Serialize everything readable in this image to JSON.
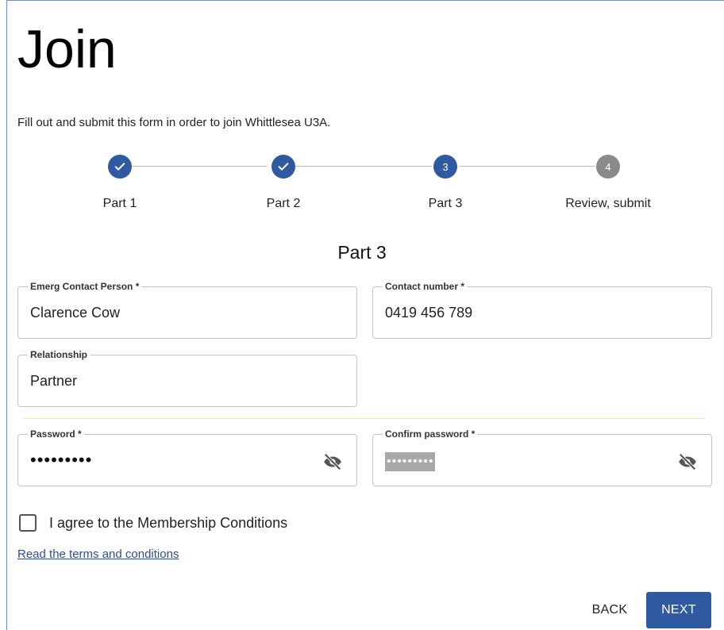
{
  "page": {
    "title": "Join",
    "intro": "Fill out and submit this form in order to join Whittlesea U3A."
  },
  "stepper": {
    "steps": [
      {
        "label": "Part 1",
        "state": "completed",
        "number": ""
      },
      {
        "label": "Part 2",
        "state": "completed",
        "number": ""
      },
      {
        "label": "Part 3",
        "state": "active",
        "number": "3"
      },
      {
        "label": "Review, submit",
        "state": "pending",
        "number": "4"
      }
    ]
  },
  "section": {
    "title": "Part 3"
  },
  "fields": {
    "emerg_contact": {
      "label": "Emerg Contact Person *",
      "value": "Clarence Cow"
    },
    "contact_number": {
      "label": "Contact number *",
      "value": "0419 456 789"
    },
    "relationship": {
      "label": "Relationship",
      "value": "Partner"
    },
    "password": {
      "label": "Password *",
      "value": "•••••••••"
    },
    "confirm_password": {
      "label": "Confirm password *",
      "value": "•••••••••"
    }
  },
  "agreement": {
    "checkbox_label": "I agree to the Membership Conditions",
    "checked": false,
    "terms_link": "Read the terms and conditions"
  },
  "actions": {
    "back_label": "BACK",
    "next_label": "NEXT"
  },
  "colors": {
    "primary": "#2f5aa2",
    "pending_step": "#8a8a8a",
    "divider": "#f3e2a8",
    "link": "#2a4f97"
  },
  "icons": {
    "step_complete": "check-icon",
    "password_toggle": "eye-off-icon"
  }
}
